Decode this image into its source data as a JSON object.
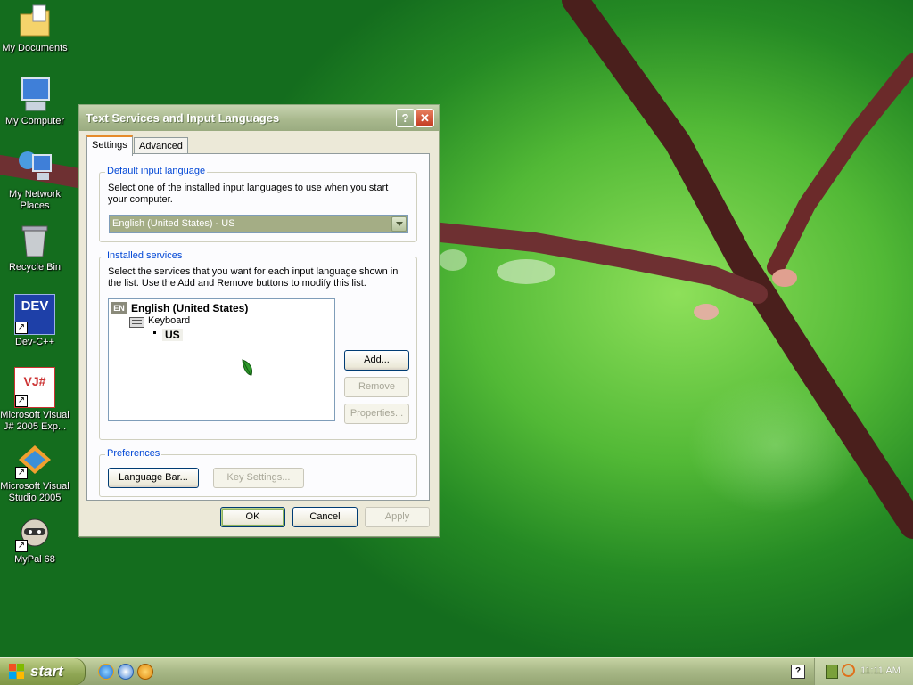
{
  "desktop": {
    "icons": [
      {
        "label": "My Documents"
      },
      {
        "label": "My Computer"
      },
      {
        "label": "My Network Places"
      },
      {
        "label": "Recycle Bin"
      },
      {
        "label": "Dev-C++",
        "icon_text": "DEV"
      },
      {
        "label": "Microsoft Visual J# 2005 Exp...",
        "icon_text": "VJ#"
      },
      {
        "label": "Microsoft Visual Studio 2005"
      },
      {
        "label": "MyPal 68"
      }
    ]
  },
  "dialog": {
    "title": "Text Services and Input Languages",
    "help_button": "?",
    "close_button": "✕",
    "tabs": [
      {
        "label": "Settings",
        "active": true
      },
      {
        "label": "Advanced",
        "active": false
      }
    ],
    "default_input": {
      "title": "Default input language",
      "description": "Select one of the installed input languages to use when you start your computer.",
      "selected": "English (United States) - US"
    },
    "installed_services": {
      "title": "Installed services",
      "description": "Select the services that you want for each input language shown in the list. Use the Add and Remove buttons to modify this list.",
      "language_badge": "EN",
      "language": "English (United States)",
      "category": "Keyboard",
      "service": "US",
      "add_button": "Add...",
      "remove_button": "Remove",
      "properties_button": "Properties..."
    },
    "preferences": {
      "title": "Preferences",
      "language_bar_button": "Language Bar...",
      "key_settings_button": "Key Settings..."
    },
    "ok_button": "OK",
    "cancel_button": "Cancel",
    "apply_button": "Apply"
  },
  "taskbar": {
    "start_label": "start",
    "clock": "11:11 AM"
  },
  "colors": {
    "desktop_green": "#52b936",
    "branch": "#4a1f1c",
    "title_bar": "#a9b98e",
    "group_title": "#0046d5"
  }
}
